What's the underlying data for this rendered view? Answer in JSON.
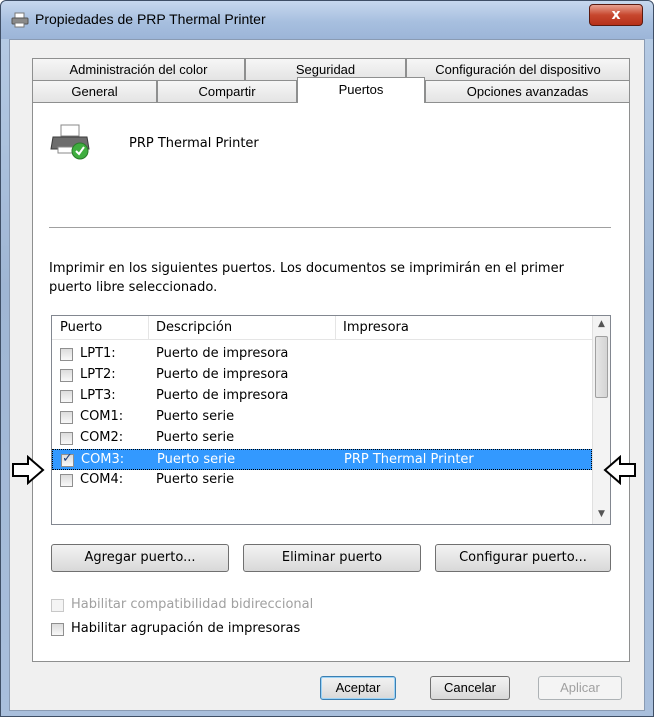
{
  "window": {
    "title": "Propiedades de PRP Thermal Printer",
    "close_label": "x"
  },
  "tabs": {
    "row_top": [
      "Administración del color",
      "Seguridad",
      "Configuración del dispositivo"
    ],
    "row_bottom": [
      "General",
      "Compartir",
      "Puertos",
      "Opciones avanzadas"
    ],
    "active": "Puertos"
  },
  "printer": {
    "name": "PRP Thermal Printer"
  },
  "description": "Imprimir en los siguientes puertos. Los documentos se imprimirán en el primer puerto libre seleccionado.",
  "ports": {
    "headers": [
      "Puerto",
      "Descripción",
      "Impresora"
    ],
    "rows": [
      {
        "port": "LPT1:",
        "description": "Puerto de impresora",
        "printer": "",
        "checked": false
      },
      {
        "port": "LPT2:",
        "description": "Puerto de impresora",
        "printer": "",
        "checked": false
      },
      {
        "port": "LPT3:",
        "description": "Puerto de impresora",
        "printer": "",
        "checked": false
      },
      {
        "port": "COM1:",
        "description": "Puerto serie",
        "printer": "",
        "checked": false
      },
      {
        "port": "COM2:",
        "description": "Puerto serie",
        "printer": "",
        "checked": false
      },
      {
        "port": "COM3:",
        "description": "Puerto serie",
        "printer": "PRP Thermal Printer",
        "checked": true
      },
      {
        "port": "COM4:",
        "description": "Puerto serie",
        "printer": "",
        "checked": false
      }
    ],
    "selected_port": "COM3:"
  },
  "actions": {
    "add": "Agregar puerto...",
    "remove": "Eliminar puerto",
    "configure": "Configurar puerto..."
  },
  "options": {
    "bidirectional": "Habilitar compatibilidad bidireccional",
    "pooling": "Habilitar agrupación de impresoras"
  },
  "footer": {
    "ok": "Aceptar",
    "cancel": "Cancelar",
    "apply": "Aplicar"
  },
  "colors": {
    "selection": "#3399ff",
    "titlebar": "#a7bfdf",
    "close": "#c7472e"
  }
}
